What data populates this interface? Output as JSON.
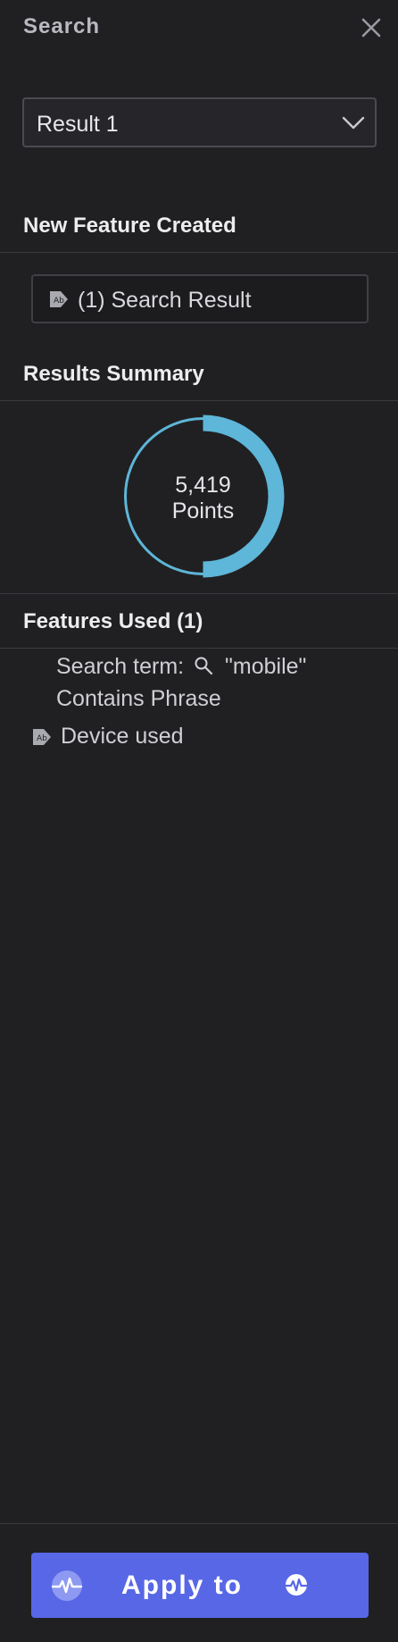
{
  "header": {
    "title": "Search",
    "close_icon": "close-icon"
  },
  "result_select": {
    "value": "Result 1",
    "icon": "chevron-down-icon"
  },
  "new_feature": {
    "heading": "New Feature Created",
    "item_label": "(1) Search Result",
    "icon": "tag-icon"
  },
  "results_summary": {
    "heading": "Results Summary",
    "count": "5,419",
    "unit": "Points",
    "fill_fraction": 0.5
  },
  "features_used": {
    "heading": "Features Used (1)",
    "search_term_label": "Search term:",
    "search_term_value": "\"mobile\"",
    "match_type": "Contains Phrase",
    "feature_name": "Device used"
  },
  "footer": {
    "apply_label": "Apply to"
  },
  "colors": {
    "background": "#202023",
    "accent": "#5767e6",
    "donut": "#5eb6d8",
    "divider": "#3a3a40"
  }
}
